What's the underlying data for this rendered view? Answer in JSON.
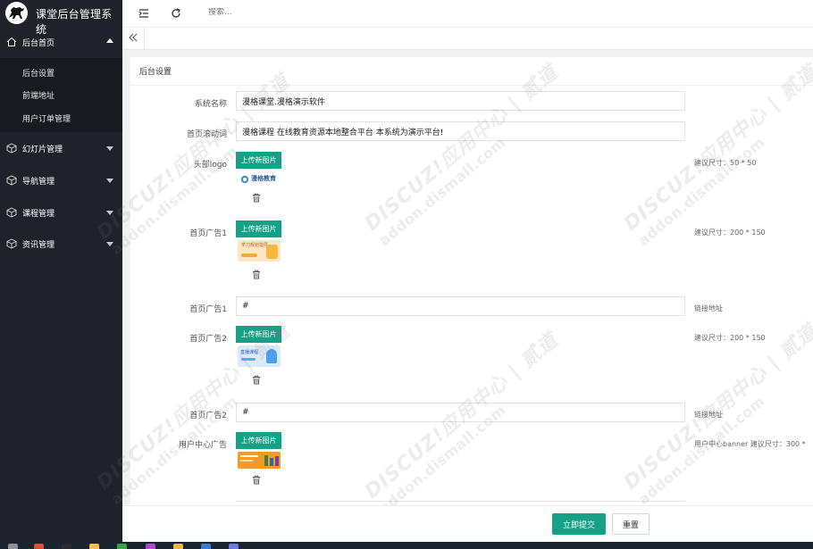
{
  "app": {
    "title": "课堂后台管理系统"
  },
  "sidebar": {
    "items": [
      {
        "label": "后台首页",
        "icon": "home-icon",
        "expanded": true
      },
      {
        "label": "幻灯片管理",
        "icon": "cube-icon",
        "expanded": false
      },
      {
        "label": "导航管理",
        "icon": "cube-icon",
        "expanded": false
      },
      {
        "label": "课程管理",
        "icon": "cube-icon",
        "expanded": false
      },
      {
        "label": "资讯管理",
        "icon": "cube-icon",
        "expanded": false
      }
    ],
    "subitems": [
      {
        "label": "后台设置"
      },
      {
        "label": "前端地址"
      },
      {
        "label": "用户订单管理"
      }
    ]
  },
  "topbar": {
    "search_placeholder": "搜索..."
  },
  "form": {
    "section_title": "后台设置",
    "site_name": {
      "label": "系统名称",
      "value": "漫格课堂.漫格演示软件"
    },
    "marquee": {
      "label": "首页滚动词",
      "value": "漫格课程 在线教育资源本地整合平台 本系统为演示平台!"
    },
    "logo": {
      "label": "头部logo",
      "button": "上传新图片",
      "hint": "建议尺寸：50 * 50",
      "preview_text": "漫格教育"
    },
    "ad1_image": {
      "label": "首页广告1",
      "button": "上传新图片",
      "hint": "建议尺寸：200 * 150",
      "preview_text": "学习规划指导"
    },
    "ad1_link": {
      "label": "首页广告1",
      "value": "#",
      "hint": "链接地址"
    },
    "ad2_image": {
      "label": "首页广告2",
      "button": "上传新图片",
      "hint": "建议尺寸：200 * 150",
      "preview_text": "直播课程"
    },
    "ad2_link": {
      "label": "首页广告2",
      "value": "#",
      "hint": "链接地址"
    },
    "user_ad": {
      "label": "用户中心广告",
      "button": "上传新图片",
      "hint": "用户中心banner 建议尺寸：300 *"
    }
  },
  "actions": {
    "submit": "立即提交",
    "reset": "重置"
  },
  "watermark": {
    "line1": "DISCUZ!应用中心 | 贰道",
    "line2": "addon.dismall.com"
  },
  "colors": {
    "sidebar": "#20222a",
    "accent": "#16a085"
  }
}
